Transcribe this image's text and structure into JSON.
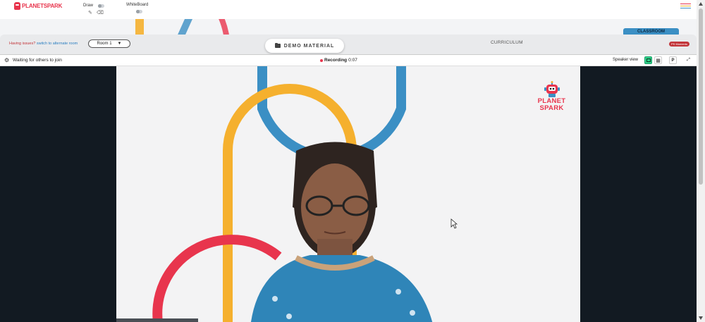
{
  "brand": {
    "logo_text": "PLANETSPARK",
    "color": "#e8354d"
  },
  "toolbar": {
    "draw_label": "Draw",
    "whiteboard_label": "WhiteBoard"
  },
  "banner": {
    "issue_text": "Having issues?",
    "switch_text": "switch to alternate room",
    "room_value": "Room 1",
    "demo_button": "DEMO MATERIAL",
    "curriculum_label": "CURRICULUM",
    "classroom_tab": "CLASSROOM",
    "moments_badge": "PS Moments"
  },
  "call": {
    "waiting_text": "Waiting for others to join",
    "recording_label": "Recording",
    "recording_time": "0:07",
    "speaker_view_label": "Speaker view",
    "p_button": "P"
  },
  "stage_logo": {
    "line1": "PLANET",
    "line2": "SPARK"
  },
  "colors": {
    "accent_blue": "#3b8fc4",
    "accent_yellow": "#f5b02e",
    "accent_red": "#e8354d",
    "green": "#2fd08a"
  }
}
